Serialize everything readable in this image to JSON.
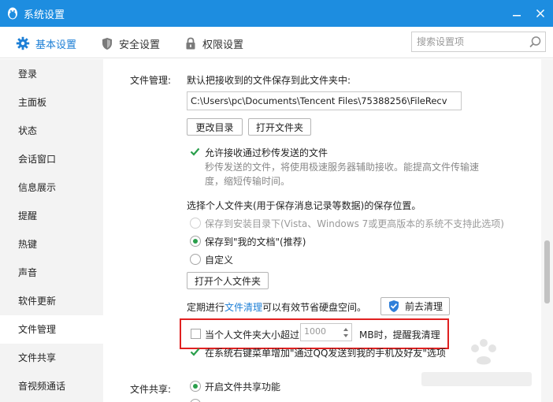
{
  "window": {
    "title": "系统设置"
  },
  "tabs": [
    {
      "label": "基本设置",
      "icon": "gear-icon",
      "active": true
    },
    {
      "label": "安全设置",
      "icon": "shield-icon",
      "active": false
    },
    {
      "label": "权限设置",
      "icon": "lock-icon",
      "active": false
    }
  ],
  "search": {
    "placeholder": "搜索设置项",
    "value": ""
  },
  "sidebar": {
    "items": [
      {
        "label": "登录"
      },
      {
        "label": "主面板"
      },
      {
        "label": "状态"
      },
      {
        "label": "会话窗口"
      },
      {
        "label": "信息展示"
      },
      {
        "label": "提醒"
      },
      {
        "label": "热键"
      },
      {
        "label": "声音"
      },
      {
        "label": "软件更新"
      },
      {
        "label": "文件管理",
        "active": true
      },
      {
        "label": "文件共享"
      },
      {
        "label": "音视频通话"
      }
    ]
  },
  "file_management": {
    "section_label": "文件管理:",
    "save_prompt": "默认把接收到的文件保存到此文件夹中:",
    "path": "C:\\Users\\pc\\Documents\\Tencent Files\\75388256\\FileRecv",
    "change_dir_label": "更改目录",
    "open_folder_label": "打开文件夹",
    "allow_transfer_label": "允许接收通过秒传发送的文件",
    "allow_transfer_desc_1": "秒传发送的文件，将使用极速服务器辅助接收。能提高文件传输速",
    "allow_transfer_desc_2": "度，缩短传输时间。",
    "personal_folder_prompt": "选择个人文件夹(用于保存消息记录等数据)的保存位置。",
    "option_install_dir": "保存到安装目录下(Vista、Windows 7或更高版本的系统不支持此选项)",
    "option_my_docs": "保存到\"我的文档\"(推荐)",
    "option_custom": "自定义",
    "open_personal_label": "打开个人文件夹",
    "cleanup_prefix": "定期进行",
    "cleanup_link": "文件清理",
    "cleanup_suffix": "可以有效节省硬盘空间。",
    "cleanup_button_label": "前去清理",
    "size_limit_prefix": "当个人文件夹大小超过",
    "size_limit_value": "1000",
    "size_limit_suffix": "MB时，提醒我清理",
    "context_menu_label": "在系统右键菜单增加\"通过QQ发送到我的手机及好友\"选项"
  },
  "file_sharing": {
    "section_label": "文件共享:",
    "enable_label": "开启文件共享功能"
  },
  "colors": {
    "titlebar": "#1d8de0",
    "accent": "#1d7fd6",
    "highlight_box": "#e02020",
    "check_green": "#2a9f4c"
  }
}
